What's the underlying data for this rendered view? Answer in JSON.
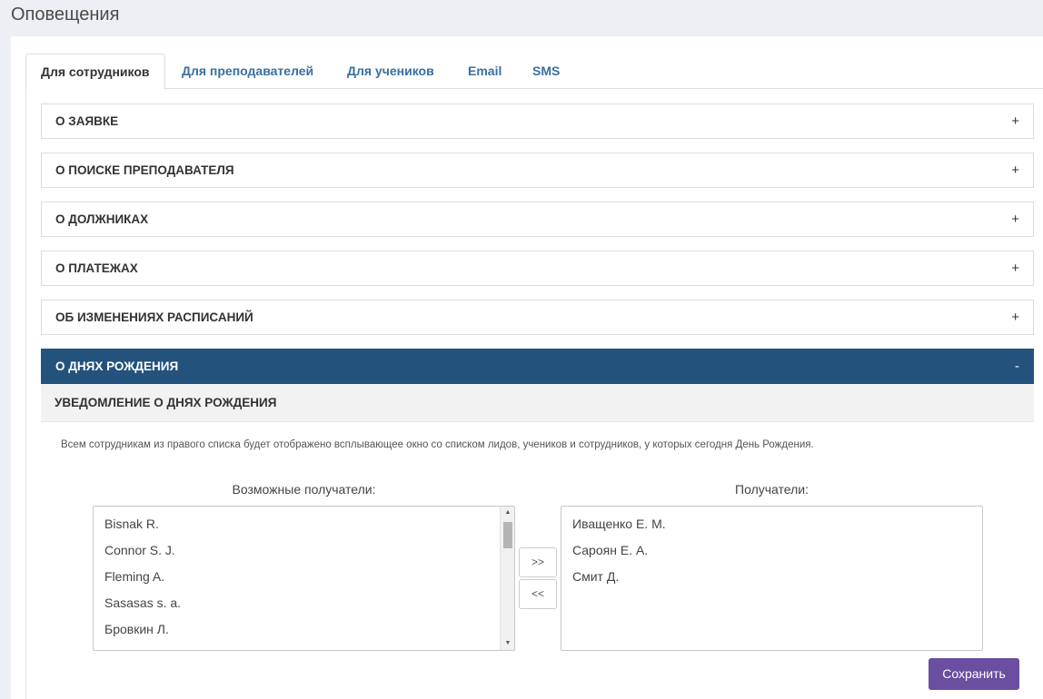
{
  "page": {
    "title": "Оповещения"
  },
  "tabs": [
    {
      "label": "Для сотрудников",
      "active": true
    },
    {
      "label": "Для преподавателей"
    },
    {
      "label": "Для учеников"
    },
    {
      "label": "Email"
    },
    {
      "label": "SMS"
    }
  ],
  "panels": [
    {
      "label": "О ЗАЯВКЕ",
      "toggle": "+"
    },
    {
      "label": "О ПОИСКЕ ПРЕПОДАВАТЕЛЯ",
      "toggle": "+"
    },
    {
      "label": "О ДОЛЖНИКАХ",
      "toggle": "+"
    },
    {
      "label": "О ПЛАТЕЖАХ",
      "toggle": "+"
    },
    {
      "label": "ОБ ИЗМЕНЕНИЯХ РАСПИСАНИЙ",
      "toggle": "+"
    },
    {
      "label": "О ДНЯХ РОЖДЕНИЯ",
      "toggle": "-",
      "open": true
    }
  ],
  "birthday": {
    "section_title": "УВЕДОМЛЕНИЕ О ДНЯХ РОЖДЕНИЯ",
    "description": "Всем сотрудникам из правого списка будет отображено всплывающее окно со списком лидов, учеников и сотрудников, у которых сегодня День Рождения.",
    "available_label": "Возможные получатели:",
    "available": [
      "Bisnak R.",
      "Connor S. J.",
      "Fleming A.",
      "Sasasas s. a.",
      "Бровкин Л."
    ],
    "recipients_label": "Получатели:",
    "recipients": [
      "Иващенко Е. М.",
      "Сароян Е. А.",
      "Смит Д."
    ],
    "move_right_label": ">>",
    "move_left_label": "<<",
    "save_label": "Сохранить"
  },
  "colors": {
    "accent": "#23527c",
    "save_button": "#6a4ea0",
    "tab_link": "#3a6fa0"
  }
}
